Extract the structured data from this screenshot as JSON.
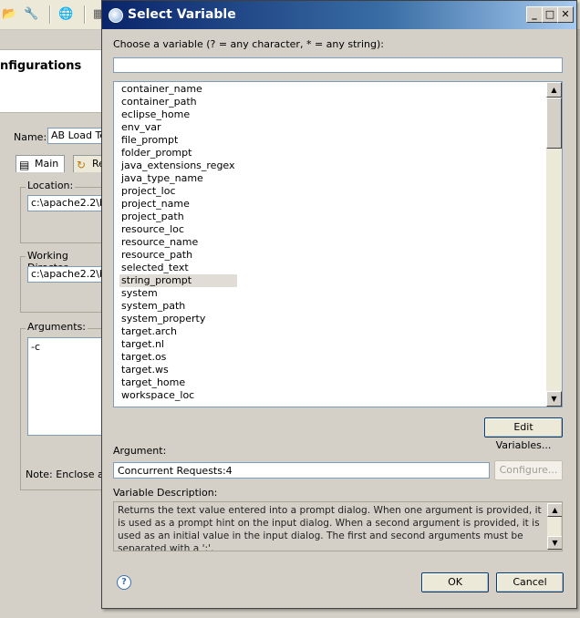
{
  "background_window": {
    "toolbar_icons": [
      "open-folder-icon",
      "wrench-icon",
      "globe-icon",
      "document-icon"
    ],
    "header_title": "nfigurations",
    "name_label": "Name:",
    "name_value": "AB Load Te",
    "tabs": [
      {
        "label": "Main",
        "icon": "main-tab-icon"
      },
      {
        "label": "Re",
        "icon": "refresh-tab-icon"
      }
    ],
    "location_label": "Location:",
    "location_value": "c:\\apache2.2\\b",
    "working_dir_label": "Working Director",
    "working_dir_value": "c:\\apache2.2\\b",
    "arguments_label": "Arguments:",
    "arguments_value": "-c",
    "note_text": "Note: Enclose an"
  },
  "dialog": {
    "title": "Select Variable",
    "window_buttons": {
      "minimize": "_",
      "maximize": "□",
      "close": "✕"
    },
    "choose_label": "Choose a variable (? = any character, * = any string):",
    "filter_value": "",
    "variables": [
      "container_name",
      "container_path",
      "eclipse_home",
      "env_var",
      "file_prompt",
      "folder_prompt",
      "java_extensions_regex",
      "java_type_name",
      "project_loc",
      "project_name",
      "project_path",
      "resource_loc",
      "resource_name",
      "resource_path",
      "selected_text",
      "string_prompt",
      "system",
      "system_path",
      "system_property",
      "target.arch",
      "target.nl",
      "target.os",
      "target.ws",
      "target_home",
      "workspace_loc"
    ],
    "selected_variable": "string_prompt",
    "edit_variables_label": "Edit Variables...",
    "argument_label": "Argument:",
    "argument_value": "Concurrent Requests:4",
    "configure_label": "Configure...",
    "description_label": "Variable Description:",
    "description_text": "Returns the text value entered into a prompt dialog. When one argument is provided, it is used as a prompt hint on the input dialog. When a second argument is provided, it is used as an initial value in the input dialog. The first and second arguments must be separated with a ':'.",
    "ok_label": "OK",
    "cancel_label": "Cancel",
    "help_icon": "?"
  }
}
